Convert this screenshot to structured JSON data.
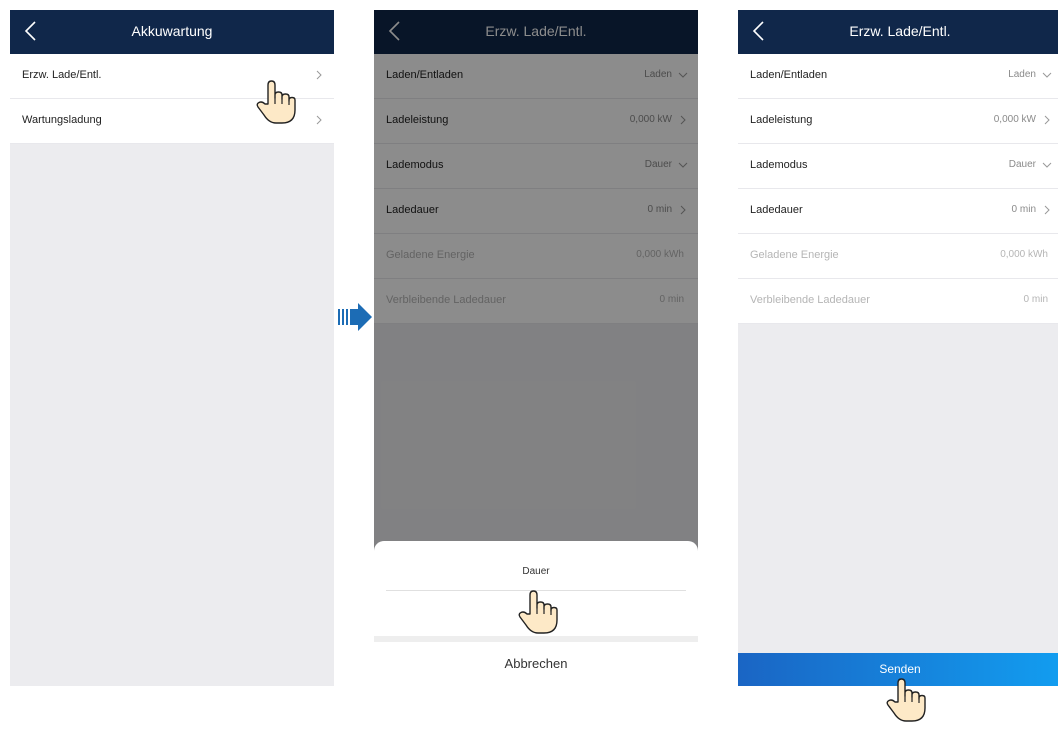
{
  "screen1": {
    "title": "Akkuwartung",
    "items": [
      {
        "label": "Erzw. Lade/Entl."
      },
      {
        "label": "Wartungsladung"
      }
    ]
  },
  "screen2": {
    "title": "Erzw. Lade/Entl.",
    "rows": [
      {
        "label": "Laden/Entladen",
        "value": "Laden"
      },
      {
        "label": "Ladeleistung",
        "value": "0,000 kW"
      },
      {
        "label": "Lademodus",
        "value": "Dauer"
      },
      {
        "label": "Ladedauer",
        "value": "0 min"
      },
      {
        "label": "Geladene Energie",
        "value": "0,000 kWh"
      },
      {
        "label": "Verbleibende Ladedauer",
        "value": "0 min"
      }
    ],
    "sheet": {
      "option": "Dauer",
      "cancel": "Abbrechen"
    }
  },
  "screen3": {
    "title": "Erzw. Lade/Entl.",
    "rows": [
      {
        "label": "Laden/Entladen",
        "value": "Laden"
      },
      {
        "label": "Ladeleistung",
        "value": "0,000 kW"
      },
      {
        "label": "Lademodus",
        "value": "Dauer"
      },
      {
        "label": "Ladedauer",
        "value": "0 min"
      },
      {
        "label": "Geladene Energie",
        "value": "0,000 kWh"
      },
      {
        "label": "Verbleibende Ladedauer",
        "value": "0 min"
      }
    ],
    "send": "Senden"
  },
  "icons": {
    "back": "chevron-left-icon",
    "row_next": "chevron-right-icon",
    "row_dropdown": "chevron-down-icon",
    "hand": "pointing-hand-icon",
    "flow": "arrow-right-icon"
  },
  "colors": {
    "header": "#10274a",
    "send_start": "#1a65c4",
    "send_end": "#129df0",
    "background": "#ececef"
  }
}
